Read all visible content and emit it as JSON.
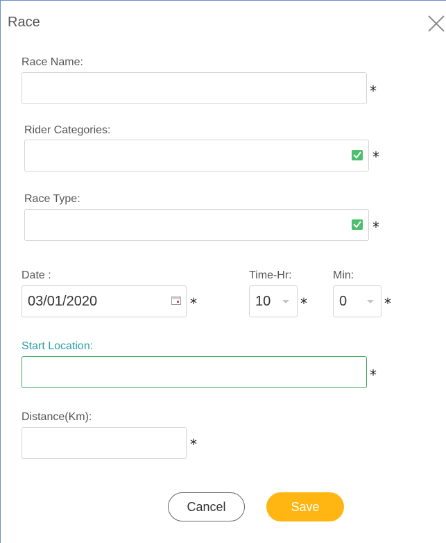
{
  "dialog": {
    "title": "Race"
  },
  "fields": {
    "race_name": {
      "label": "Race Name:",
      "value": ""
    },
    "rider_categories": {
      "label": "Rider Categories:",
      "value": ""
    },
    "race_type": {
      "label": "Race Type:",
      "value": ""
    },
    "date": {
      "label": "Date :",
      "value": "03/01/2020"
    },
    "time_hr": {
      "label": "Time-Hr:",
      "value": "10"
    },
    "min": {
      "label": "Min:",
      "value": "0"
    },
    "start_location": {
      "label": "Start Location:",
      "value": ""
    },
    "distance": {
      "label": "Distance(Km):",
      "value": ""
    }
  },
  "required_marker": "*",
  "buttons": {
    "cancel": "Cancel",
    "save": "Save"
  },
  "colors": {
    "accent_teal": "#2aa0a8",
    "focus_green": "#3fa55c",
    "save_yellow": "#ffb612",
    "check_green": "#4cbf6e"
  },
  "icons": {
    "close": "close-icon",
    "check": "check-icon",
    "calendar": "calendar-icon",
    "dropdown": "chevron-down-icon"
  }
}
